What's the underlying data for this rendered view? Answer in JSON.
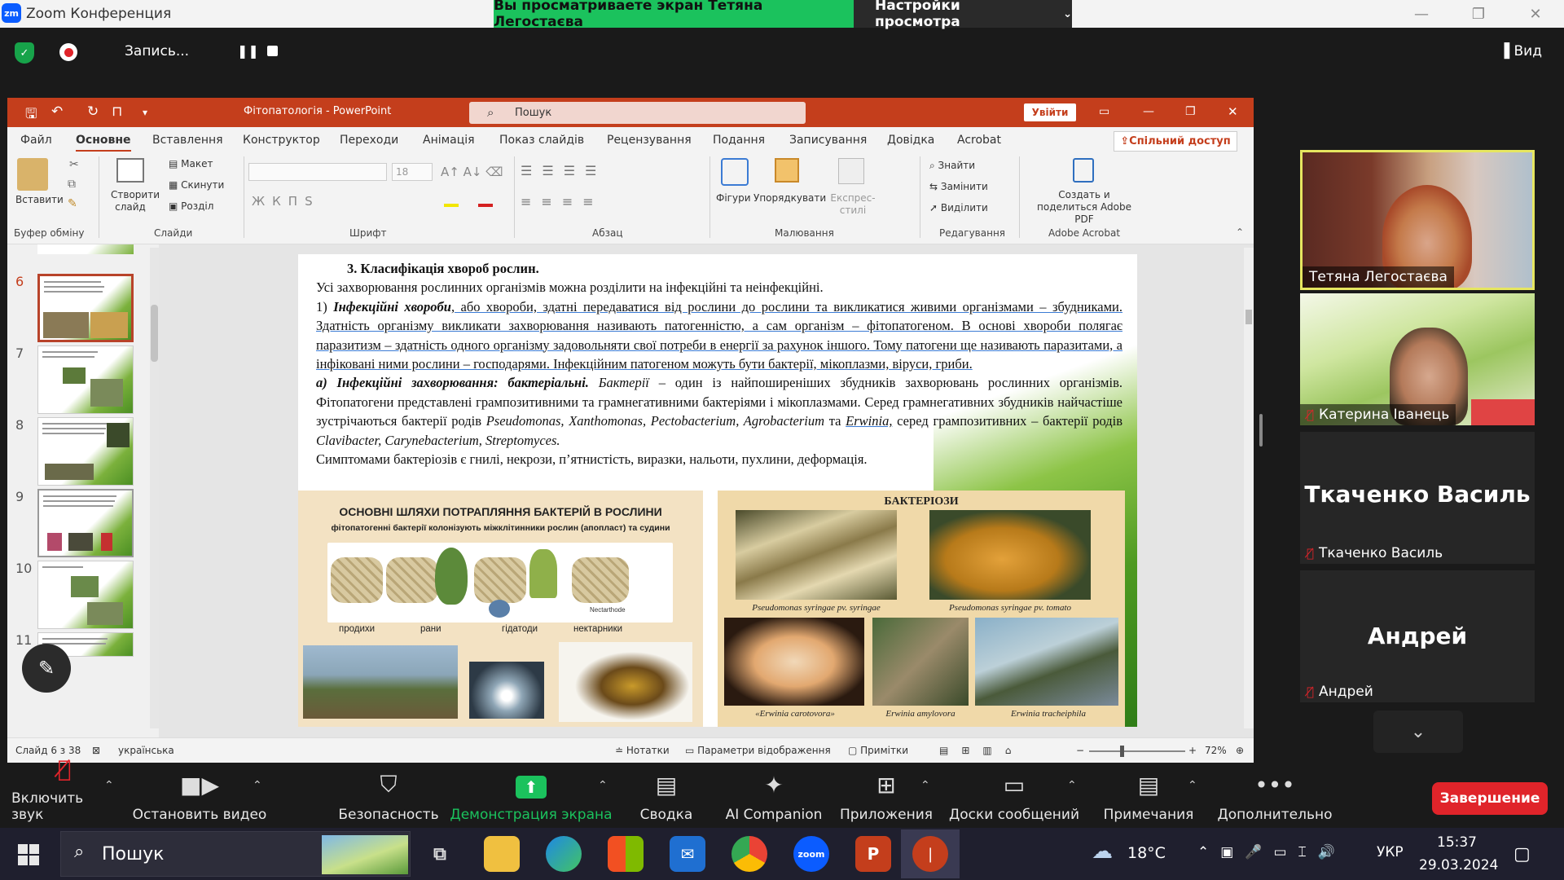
{
  "zoom": {
    "window_title": "Zoom Конференция",
    "logo_text": "zm",
    "share_banner": "Вы просматриваете экран Тетяна Легостаєва",
    "view_settings": "Настройки просмотра",
    "recording_label": "Запись...",
    "view_button": "Вид"
  },
  "ppt": {
    "title": "Фітопатологія - PowerPoint",
    "search_placeholder": "Пошук",
    "login_button": "Увійти",
    "share_access": "Спільний доступ",
    "tabs": [
      "Файл",
      "Основне",
      "Вставлення",
      "Конструктор",
      "Переходи",
      "Анімація",
      "Показ слайдів",
      "Рецензування",
      "Подання",
      "Записування",
      "Довідка",
      "Acrobat"
    ],
    "active_tab": "Основне",
    "ribbon": {
      "paste": "Вставити",
      "create_slide": "Створити слайд",
      "layout": "Макет",
      "reset": "Скинути",
      "section": "Розділ",
      "font_size": "18",
      "shapes": "Фігури",
      "arrange": "Упорядкувати",
      "express_styles": "Експрес-стилі",
      "find": "Знайти",
      "replace": "Замінити",
      "select": "Виділити",
      "create_pdf": "Создать и поделиться Adobe PDF",
      "groups": [
        "Буфер обміну",
        "Слайди",
        "Шрифт",
        "Абзац",
        "Малювання",
        "Редагування",
        "Adobe Acrobat"
      ]
    },
    "thumb_numbers": [
      "6",
      "7",
      "8",
      "9",
      "10",
      "11"
    ],
    "status": {
      "slide_of": "Слайд 6 з 38",
      "language": "українська",
      "notes": "Нотатки",
      "display_settings": "Параметри відображення",
      "comments": "Примітки",
      "zoom": "72%"
    }
  },
  "slide": {
    "title": "3. Класифікація хвороб рослин.",
    "intro": "Усі захворювання рослинних організмів можна розділити на інфекційні та неінфекційні.",
    "p1_num": "1)",
    "p1_bold": "Інфекційні хвороби",
    "p1_text": ", або хвороби, здатні передаватися від рослини до рослини та викликатися живими організмами – збудниками. Здатність організму викликати захворювання називають патогенністю, а сам організм – фітопатогеном. В основі хвороби полягає паразитизм – здатність одного організму задовольняти свої потреби в енергії за рахунок іншого. Тому патогени ще називають паразитами, а інфіковані ними рослини – господарями. Інфекційним патогеном можуть бути бактерії, мікоплазми, віруси, гриби.",
    "p2_bold": "а) Інфекційні захворювання: бактеріальні.",
    "p2_italic": "Бактерії",
    "p2_text1": " – один із найпоширеніших збудників захворювань рослинних організмів. Фітопатогени представлені грампозитивними та грамнегативними бактеріями і мікоплазмами. Серед грамнегативних збудників найчастіше зустрічаються бактерії родів ",
    "p2_genera1": "Pseudomonas, Xanthomonas, Pectobacterium, Agrobacterium",
    "p2_and": " та ",
    "p2_erwinia": "Erwinia,",
    "p2_text2": " серед грампозитивних – бактерії родів ",
    "p2_genera2": "Clavibacter, Carynebacterium, Streptomyces.",
    "p2_symptoms": "Симптомами бактеріозів є гнилі, некрози, п’ятнистість, виразки, нальоти, пухлини, деформація.",
    "left_panel": {
      "title": "ОСНОВНІ ШЛЯХИ ПОТРАПЛЯННЯ БАКТЕРІЙ В РОСЛИНИ",
      "subtitle": "фітопатогенні бактерії колонізують міжклітинники рослин (апопласт) та судини",
      "nectar_label": "Nectarthode",
      "labels": [
        "продихи",
        "рани",
        "гідатоди",
        "нектарники"
      ]
    },
    "right_panel": {
      "title": "БАКТЕРІОЗИ",
      "captions": [
        "Pseudomonas syringae pv. syringae",
        "Pseudomonas syringae pv. tomato",
        "«Erwinia carotovora»",
        "Erwinia amylovora",
        "Erwinia tracheiphila"
      ]
    }
  },
  "participants": [
    {
      "name": "Тетяна Легостаєва",
      "muted": false
    },
    {
      "name": "Катерина Іванець",
      "muted": true
    },
    {
      "name": "Ткаченко Василь",
      "muted": true
    },
    {
      "name": "Андрей",
      "muted": true
    }
  ],
  "toolbar": {
    "unmute": "Включить звук",
    "stop_video": "Остановить видео",
    "security": "Безопасность",
    "share_screen": "Демонстрация экрана",
    "summary": "Сводка",
    "ai_companion": "AI Companion",
    "apps": "Приложения",
    "whiteboards": "Доски сообщений",
    "notes": "Примечания",
    "more": "Дополнительно",
    "end": "Завершение"
  },
  "taskbar": {
    "search": "Пошук",
    "weather": "18°C",
    "lang": "УКР",
    "time": "15:37",
    "date": "29.03.2024"
  },
  "colors": {
    "ppt_accent": "#c43e1c",
    "zoom_green": "#1bc25d",
    "end_red": "#e0242a"
  }
}
